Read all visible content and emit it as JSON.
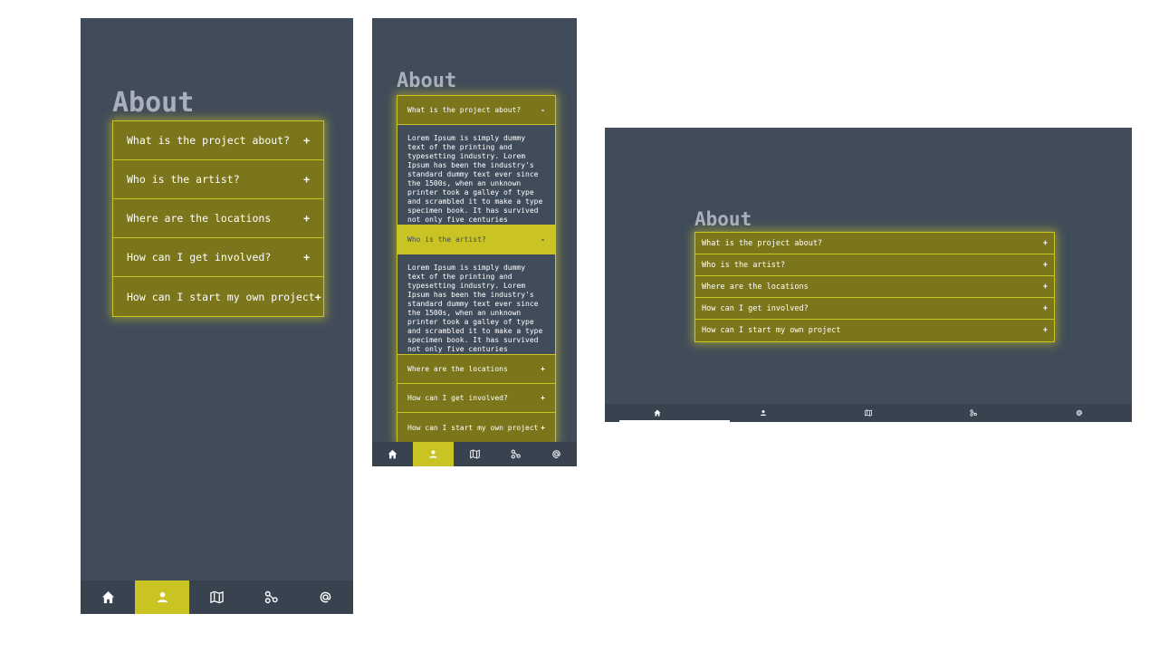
{
  "about_title": "About",
  "faq": [
    {
      "question": "What is the project about?",
      "icon": "+"
    },
    {
      "question": "Who is the artist?",
      "icon": "+"
    },
    {
      "question": "Where are the locations",
      "icon": "+"
    },
    {
      "question": "How can I get involved?",
      "icon": "+"
    },
    {
      "question": "How can I start my own project",
      "icon": "+"
    }
  ],
  "expanded_icon": "-",
  "answer_text": "Lorem Ipsum is simply dummy text of the printing and typesetting industry. Lorem Ipsum has been the industry's standard dummy text ever since the 1500s, when an unknown printer took a galley of type and scrambled it to make a type specimen book. It has survived not only five centuries",
  "nav": [
    {
      "name": "home",
      "icon": "home-icon"
    },
    {
      "name": "about",
      "icon": "person-icon"
    },
    {
      "name": "map",
      "icon": "map-icon"
    },
    {
      "name": "share",
      "icon": "share-icon"
    },
    {
      "name": "contact",
      "icon": "at-icon"
    }
  ],
  "colors": {
    "background": "#414c5a",
    "accent": "#c9c323",
    "accordion_fill": "#7b761c",
    "navbar": "#394350",
    "heading": "#a9b0bb"
  }
}
